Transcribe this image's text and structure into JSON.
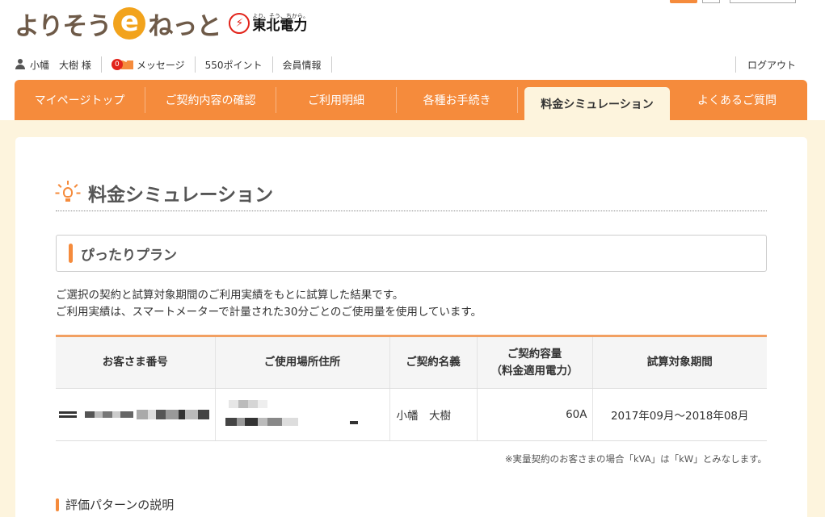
{
  "brand": {
    "logo_prefix": "よりそう",
    "logo_e": "e",
    "logo_suffix": "ねっと",
    "company_mark": "⚡",
    "company_slogan": "より、そう、ちから。",
    "company_name": "東北電力"
  },
  "user_bar": {
    "user_name": "小幡　大樹 様",
    "message_count": "0",
    "messages_label": "メッセージ",
    "points": "550ポイント",
    "member_info": "会員情報",
    "logout": "ログアウト"
  },
  "nav": {
    "items": [
      {
        "label": "マイページトップ"
      },
      {
        "label": "ご契約内容の確認"
      },
      {
        "label": "ご利用明細"
      },
      {
        "label": "各種お手続き"
      },
      {
        "label": "料金シミュレーション"
      },
      {
        "label": "よくあるご質問"
      }
    ],
    "active_index": 4
  },
  "page": {
    "title": "料金シミュレーション",
    "section_title": "ぴったりプラン",
    "desc_line1": "ご選択の契約と試算対象期間のご利用実績をもとに試算した結果です。",
    "desc_line2": "ご利用実績は、スマートメーターで計量された30分ごとのご使用量を使用しています。",
    "note": "※実量契約のお客さまの場合「kVA」は「kW」とみなします。",
    "eval_title": "評価パターンの説明"
  },
  "table": {
    "headers": {
      "customer_no": "お客さま番号",
      "address": "ご使用場所住所",
      "contract_name": "ご契約名義",
      "capacity_line1": "ご契約容量",
      "capacity_line2": "（料金適用電力）",
      "period": "試算対象期間"
    },
    "row": {
      "contract_name": "小幡　大樹",
      "capacity": "60A",
      "period": "2017年09月～2018年08月"
    }
  },
  "colors": {
    "accent": "#f58b3c",
    "content_bg": "#fdf4dd"
  }
}
